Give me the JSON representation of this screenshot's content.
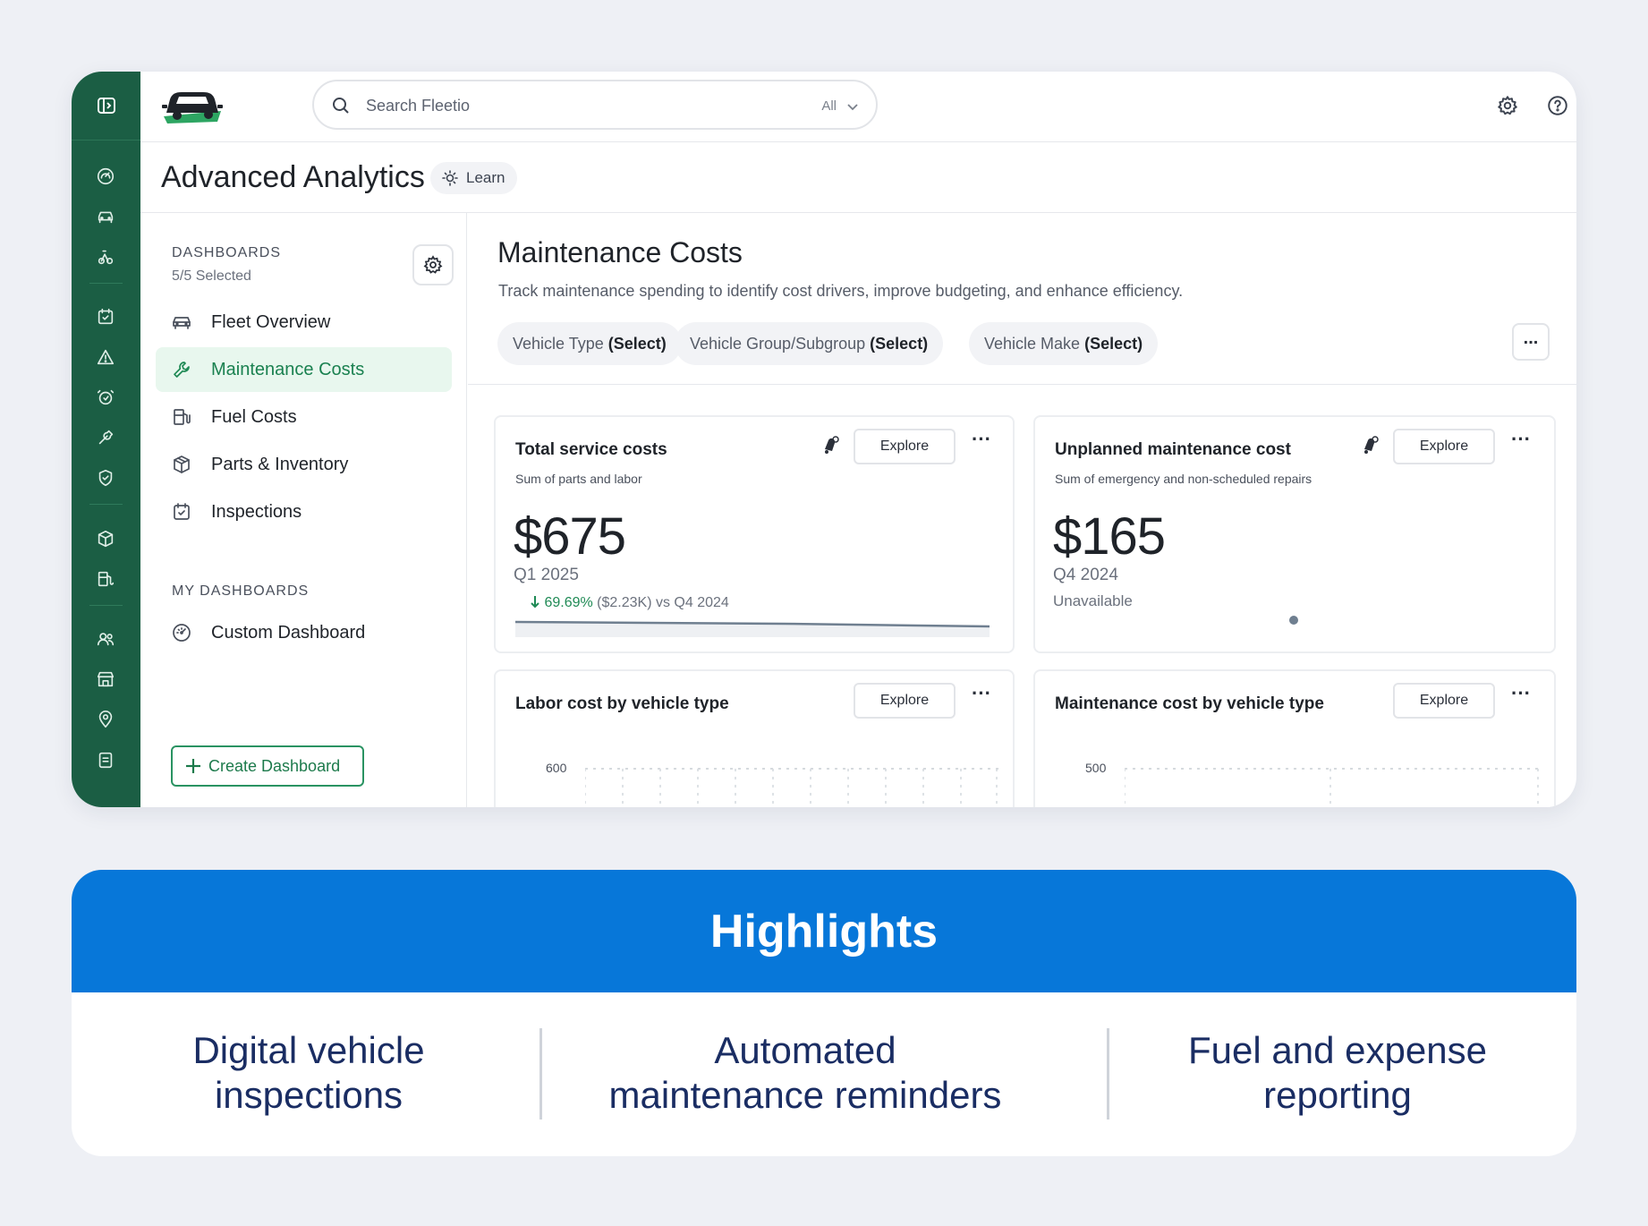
{
  "app": {
    "search_placeholder": "Search Fleetio",
    "search_scope": "All",
    "page_title": "Advanced Analytics",
    "learn_label": "Learn"
  },
  "sidebar": {
    "dashboards_heading": "DASHBOARDS",
    "dashboards_selected": "5/5 Selected",
    "items": [
      {
        "label": "Fleet Overview",
        "icon": "car-icon"
      },
      {
        "label": "Maintenance Costs",
        "icon": "wrench-icon",
        "active": true
      },
      {
        "label": "Fuel Costs",
        "icon": "fuel-pump-icon"
      },
      {
        "label": "Parts & Inventory",
        "icon": "box-icon"
      },
      {
        "label": "Inspections",
        "icon": "calendar-check-icon"
      }
    ],
    "my_dashboards_heading": "MY DASHBOARDS",
    "my_items": [
      {
        "label": "Custom Dashboard",
        "icon": "gauge-icon"
      }
    ],
    "create_label": "Create Dashboard"
  },
  "main": {
    "title": "Maintenance Costs",
    "description": "Track maintenance spending to identify cost drivers, improve budgeting, and enhance efficiency.",
    "filters": [
      {
        "label": "Vehicle Type",
        "value": "(Select)"
      },
      {
        "label": "Vehicle Group/Subgroup",
        "value": "(Select)"
      },
      {
        "label": "Vehicle Make",
        "value": "(Select)"
      }
    ],
    "more_label": "..."
  },
  "cards": {
    "explore_label": "Explore",
    "dots_label": "···",
    "total": {
      "title": "Total service costs",
      "subtitle": "Sum of parts and labor",
      "value": "$675",
      "period": "Q1 2025",
      "trend_value": "69.69%",
      "trend_rest": "($2.23K) vs Q4 2024"
    },
    "unplanned": {
      "title": "Unplanned maintenance cost",
      "subtitle": "Sum of emergency and non-scheduled repairs",
      "value": "$165",
      "period": "Q4 2024",
      "note": "Unavailable"
    },
    "labor": {
      "title": "Labor cost by vehicle type",
      "axis_top": "600"
    },
    "maint_type": {
      "title": "Maintenance cost by vehicle type",
      "axis_top": "500"
    }
  },
  "highlights": {
    "title": "Highlights",
    "items": [
      {
        "line1": "Digital vehicle",
        "line2": "inspections"
      },
      {
        "line1": "Automated",
        "line2": "maintenance reminders"
      },
      {
        "line1": "Fuel and expense",
        "line2": "reporting"
      }
    ]
  },
  "colors": {
    "rail": "#1b5e44",
    "accent_green": "#1f8a55",
    "highlight_blue": "#0777d9",
    "highlight_text": "#1a2d63"
  }
}
